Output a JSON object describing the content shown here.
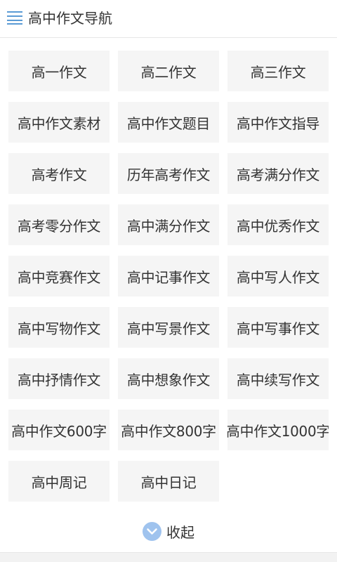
{
  "header": {
    "title": "高中作文导航",
    "menu_icon": "menu-icon"
  },
  "nav_items": [
    "高一作文",
    "高二作文",
    "高三作文",
    "高中作文素材",
    "高中作文题目",
    "高中作文指导",
    "高考作文",
    "历年高考作文",
    "高考满分作文",
    "高考零分作文",
    "高中满分作文",
    "高中优秀作文",
    "高中竞赛作文",
    "高中记事作文",
    "高中写人作文",
    "高中写物作文",
    "高中写景作文",
    "高中写事作文",
    "高中抒情作文",
    "高中想象作文",
    "高中续写作文",
    "高中作文600字",
    "高中作文800字",
    "高中作文1000字",
    "高中周记",
    "高中日记"
  ],
  "collapse": {
    "label": "收起",
    "icon": "chevron-down-circle-icon"
  },
  "colors": {
    "accent": "#9fc3ee",
    "menu_icon": "#5b9bd5",
    "cell_bg": "#f5f5f5",
    "text": "#333333"
  }
}
